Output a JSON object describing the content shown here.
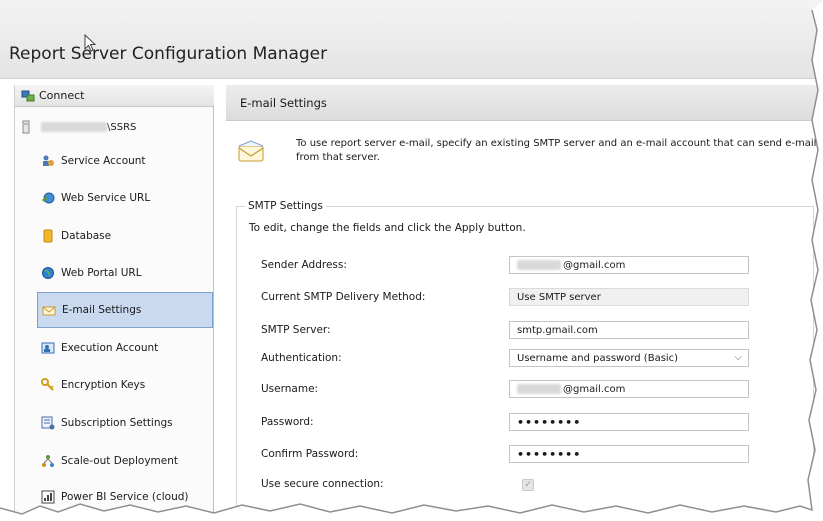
{
  "window": {
    "title": "Report Server Configuration Manager"
  },
  "sidebar": {
    "connect_label": "Connect",
    "server_suffix": "\\SSRS",
    "items": [
      {
        "label": "Service Account",
        "icon": "service-account-icon"
      },
      {
        "label": "Web Service URL",
        "icon": "web-service-icon"
      },
      {
        "label": "Database",
        "icon": "database-icon"
      },
      {
        "label": "Web Portal URL",
        "icon": "globe-icon"
      },
      {
        "label": "E-mail Settings",
        "icon": "email-icon",
        "selected": true
      },
      {
        "label": "Execution Account",
        "icon": "execution-account-icon"
      },
      {
        "label": "Encryption Keys",
        "icon": "key-icon"
      },
      {
        "label": "Subscription Settings",
        "icon": "subscription-icon"
      },
      {
        "label": "Scale-out Deployment",
        "icon": "scale-out-icon"
      },
      {
        "label": "Power BI Service (cloud)",
        "icon": "power-bi-icon"
      }
    ]
  },
  "main": {
    "header": "E-mail Settings",
    "intro": "To use report server e-mail, specify an existing SMTP server and an e-mail account that can send e-mail from that server.",
    "smtp": {
      "legend": "SMTP Settings",
      "hint": "To edit, change the fields and click the Apply button.",
      "sender_address": {
        "label": "Sender Address:",
        "value": "@gmail.com"
      },
      "delivery_method": {
        "label": "Current SMTP Delivery Method:",
        "value": "Use SMTP server"
      },
      "smtp_server": {
        "label": "SMTP Server:",
        "value": "smtp.gmail.com"
      },
      "authentication": {
        "label": "Authentication:",
        "value": "Username and password (Basic)"
      },
      "username": {
        "label": "Username:",
        "value": "@gmail.com"
      },
      "password": {
        "label": "Password:",
        "value": "••••••••"
      },
      "confirm_password": {
        "label": "Confirm Password:",
        "value": "••••••••"
      },
      "secure_connection": {
        "label": "Use secure connection:",
        "value": "✓"
      }
    }
  },
  "colors": {
    "selected_bg": "#c9daf0",
    "selected_border": "#7da2ce",
    "header_bg": "#dcdcdc"
  }
}
